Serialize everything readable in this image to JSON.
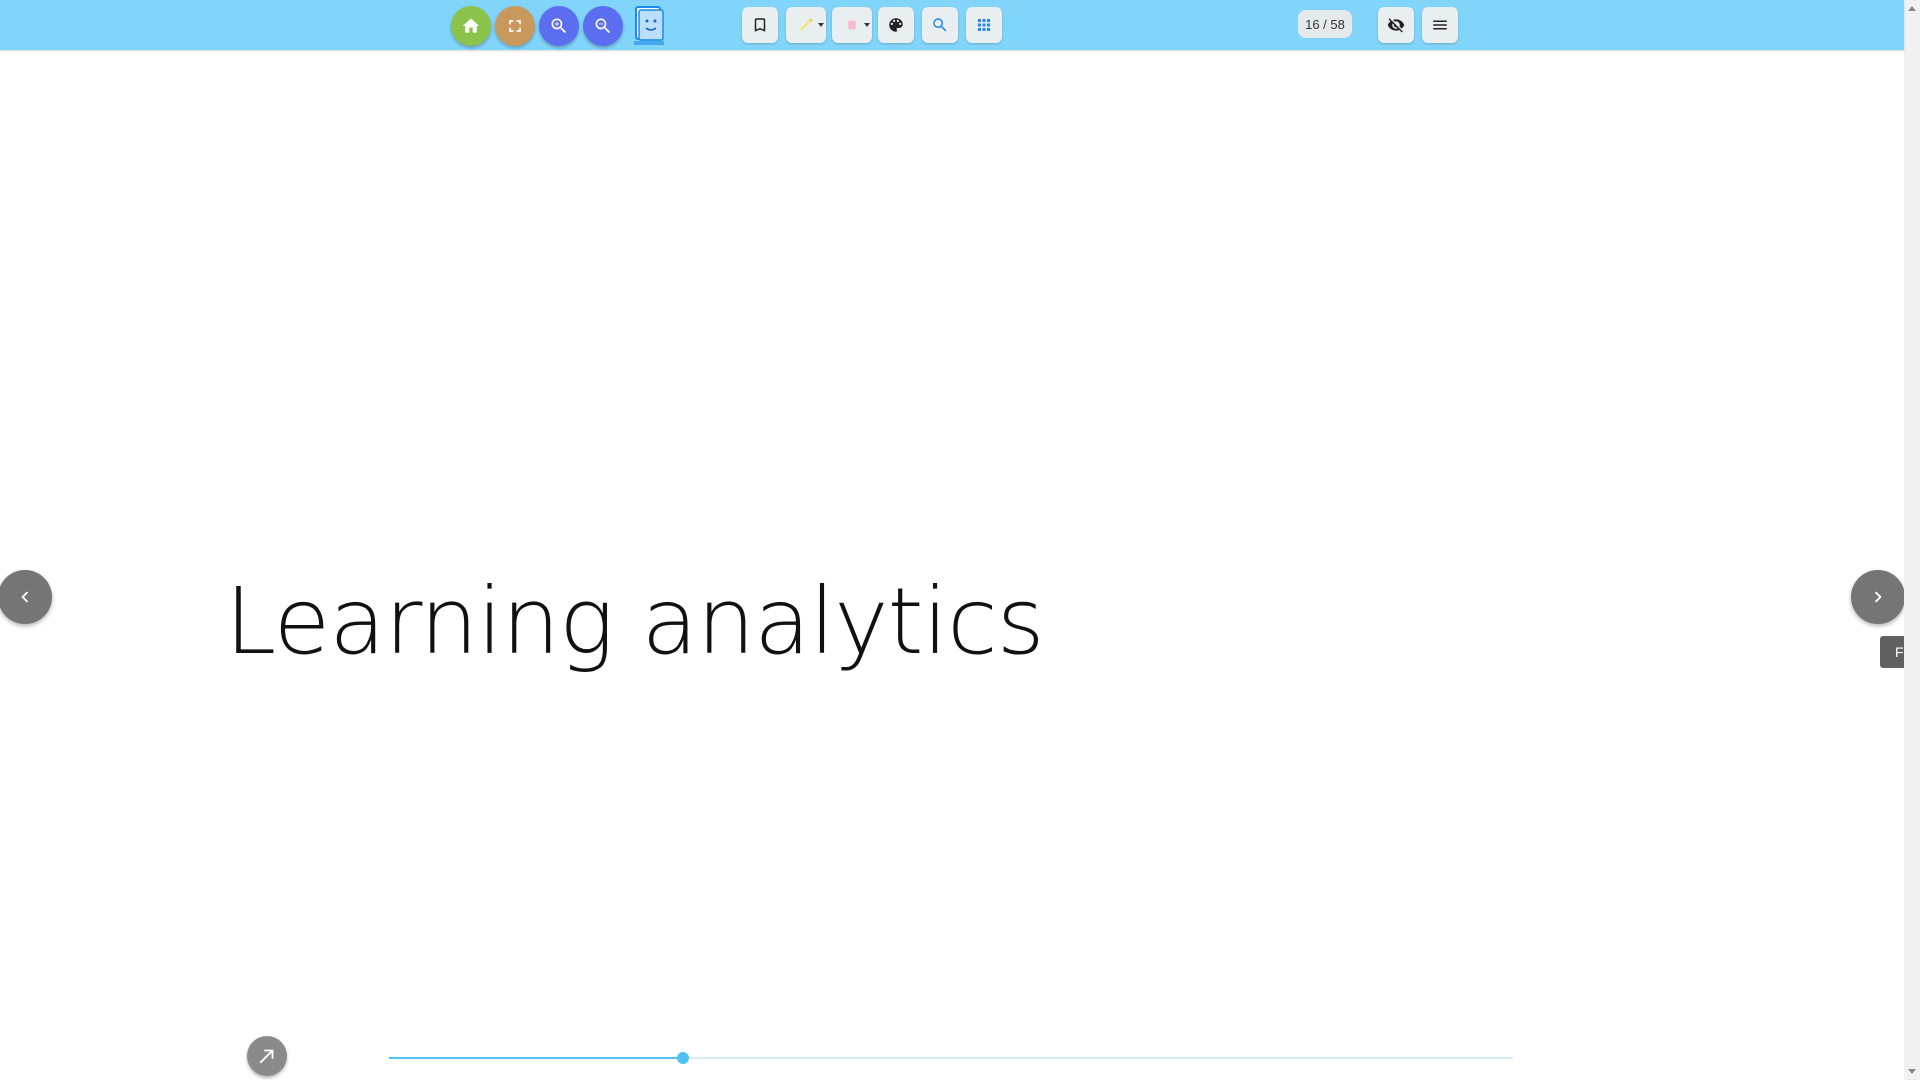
{
  "toolbar": {
    "background": "#81d4fa",
    "buttons": [
      {
        "icon": "home-icon"
      },
      {
        "icon": "fullscreen-icon"
      },
      {
        "icon": "zoom-in-icon"
      },
      {
        "icon": "zoom-out-icon"
      },
      {
        "icon": "brand-logo"
      },
      {
        "icon": "bookmark-icon"
      },
      {
        "icon": "highlighter-icon"
      },
      {
        "icon": "eraser-icon"
      },
      {
        "icon": "palette-icon"
      },
      {
        "icon": "search-icon"
      },
      {
        "icon": "grid-icon"
      },
      {
        "icon": "eye-off-icon"
      },
      {
        "icon": "menu-icon"
      }
    ],
    "page_counter": "16 / 58"
  },
  "slide": {
    "title": "Learning analytics"
  },
  "side_tab": {
    "label": "F"
  },
  "navigation": {
    "prev_icon": "chevron-left-icon",
    "next_icon": "chevron-right-icon"
  },
  "progress": {
    "current_page": 16,
    "total_pages": 58,
    "fraction": 0.262,
    "accent": "#4fc3f7"
  }
}
